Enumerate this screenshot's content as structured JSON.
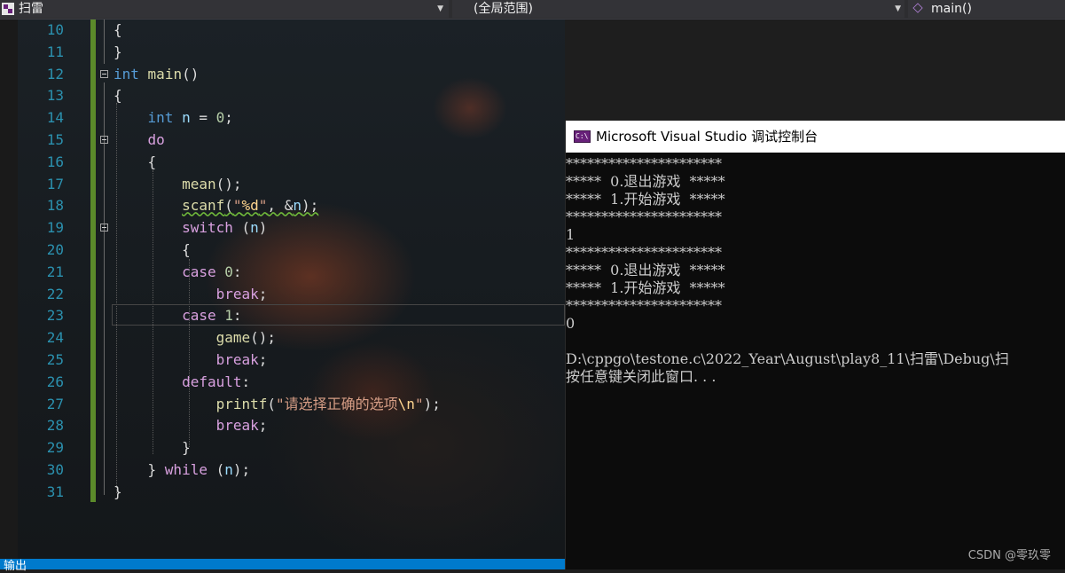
{
  "navbar": {
    "file": "扫雷",
    "scope": "(全局范围)",
    "function": "main()"
  },
  "editor": {
    "lines": [
      {
        "num": "10",
        "text": "{"
      },
      {
        "num": "11",
        "text": "}"
      },
      {
        "num": "12",
        "text": "int main()"
      },
      {
        "num": "13",
        "text": "{"
      },
      {
        "num": "14",
        "text": "    int n = 0;"
      },
      {
        "num": "15",
        "text": "    do"
      },
      {
        "num": "16",
        "text": "    {"
      },
      {
        "num": "17",
        "text": "        mean();"
      },
      {
        "num": "18",
        "text": "        scanf(\"%d\", &n);"
      },
      {
        "num": "19",
        "text": "        switch (n)"
      },
      {
        "num": "20",
        "text": "        {"
      },
      {
        "num": "21",
        "text": "        case 0:"
      },
      {
        "num": "22",
        "text": "            break;"
      },
      {
        "num": "23",
        "text": "        case 1:"
      },
      {
        "num": "24",
        "text": "            game();"
      },
      {
        "num": "25",
        "text": "            break;"
      },
      {
        "num": "26",
        "text": "        default:"
      },
      {
        "num": "27",
        "text": "            printf(\"请选择正确的选项\\n\");"
      },
      {
        "num": "28",
        "text": "            break;"
      },
      {
        "num": "29",
        "text": "        }"
      },
      {
        "num": "30",
        "text": "    } while (n);"
      },
      {
        "num": "31",
        "text": "}"
      }
    ]
  },
  "output_panel": {
    "label": "输出"
  },
  "console": {
    "title": "Microsoft Visual Studio 调试控制台",
    "lines": [
      "**********************",
      "*****  0.退出游戏  *****",
      "*****  1.开始游戏  *****",
      "**********************",
      "1",
      "**********************",
      "*****  0.退出游戏  *****",
      "*****  1.开始游戏  *****",
      "**********************",
      "0",
      "",
      "D:\\cppgo\\testone.c\\2022_Year\\August\\play8_11\\扫雷\\Debug\\扫",
      "按任意键关闭此窗口. . ."
    ]
  },
  "watermark": "CSDN @零玖零"
}
